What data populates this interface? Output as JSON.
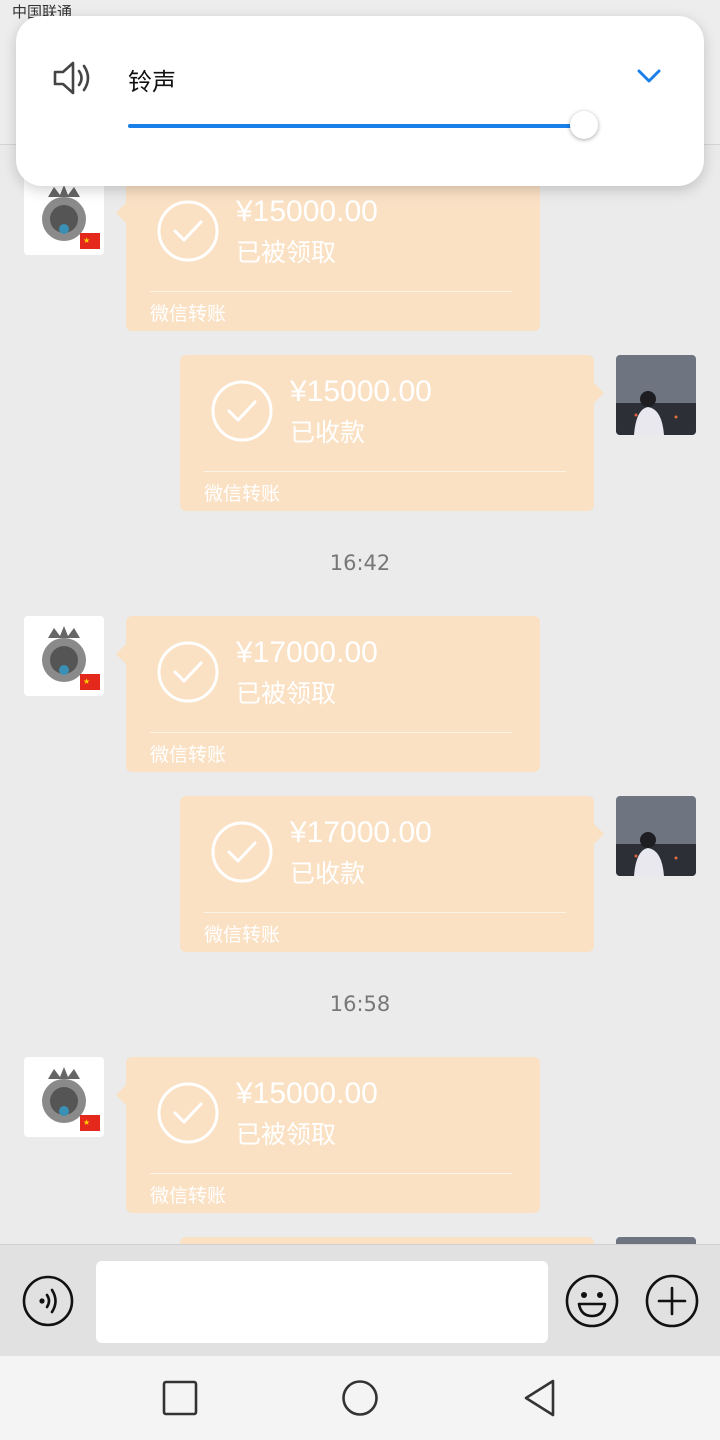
{
  "status_bar": {
    "carrier": "中国联通"
  },
  "volume_popup": {
    "label": "铃声",
    "level": 0.97,
    "icon": "speaker-icon",
    "expand_icon": "chevron-down-icon",
    "accent_color": "#1a7fe8"
  },
  "chat": {
    "colors": {
      "bubble": "#fbe1c4",
      "background": "#ebebeb"
    },
    "timestamps": [
      "16:42",
      "16:58"
    ],
    "messages": [
      {
        "side": "left",
        "amount": "¥15000.00",
        "status": "已被领取",
        "source": "微信转账"
      },
      {
        "side": "right",
        "amount": "¥15000.00",
        "status": "已收款",
        "source": "微信转账"
      },
      {
        "side": "left",
        "amount": "¥17000.00",
        "status": "已被领取",
        "source": "微信转账"
      },
      {
        "side": "right",
        "amount": "¥17000.00",
        "status": "已收款",
        "source": "微信转账"
      },
      {
        "side": "left",
        "amount": "¥15000.00",
        "status": "已被领取",
        "source": "微信转账"
      }
    ]
  },
  "input_bar": {
    "voice_icon": "voice-icon",
    "emoji_icon": "emoji-icon",
    "plus_icon": "plus-icon",
    "input_value": ""
  },
  "nav_bar": {
    "icons": [
      "recents-icon",
      "home-icon",
      "back-icon"
    ]
  }
}
